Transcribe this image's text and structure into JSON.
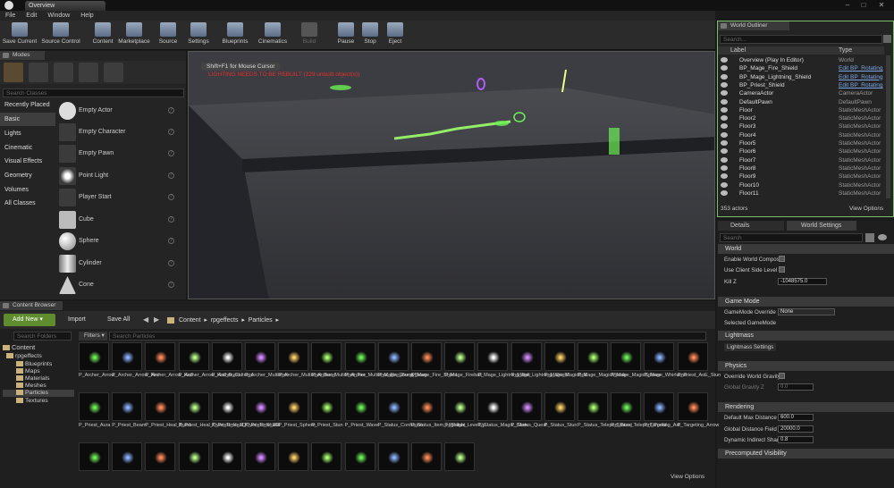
{
  "window": {
    "tab": "Overview"
  },
  "menu": [
    "File",
    "Edit",
    "Window",
    "Help"
  ],
  "toolbar": {
    "buttons": [
      {
        "label": "Save Current",
        "icon": "save-icon"
      },
      {
        "label": "Source Control",
        "icon": "source-control-icon"
      },
      {
        "label": "Content",
        "icon": "content-icon"
      },
      {
        "label": "Marketplace",
        "icon": "marketplace-icon"
      },
      {
        "label": "Source",
        "icon": "source-icon"
      },
      {
        "label": "Settings",
        "icon": "settings-icon"
      },
      {
        "label": "Blueprints",
        "icon": "blueprints-icon"
      },
      {
        "label": "Cinematics",
        "icon": "cinematics-icon"
      },
      {
        "label": "Build",
        "icon": "build-icon"
      },
      {
        "label": "Pause",
        "icon": "pause-icon"
      },
      {
        "label": "Stop",
        "icon": "stop-icon"
      },
      {
        "label": "Eject",
        "icon": "eject-icon"
      }
    ]
  },
  "modes": {
    "title": "Modes",
    "search_placeholder": "Search Classes",
    "categories": [
      "Recently Placed",
      "Basic",
      "Lights",
      "Cinematic",
      "Visual Effects",
      "Geometry",
      "Volumes",
      "All Classes"
    ],
    "selected_category": "Basic",
    "items": [
      "Empty Actor",
      "Empty Character",
      "Empty Pawn",
      "Point Light",
      "Player Start",
      "Cube",
      "Sphere",
      "Cylinder",
      "Cone"
    ]
  },
  "viewport": {
    "hint": "Shift+F1 for Mouse Cursor",
    "warning": "LIGHTING NEEDS TO BE REBUILT (229 unbuilt object(s))"
  },
  "world_outliner": {
    "title": "World Outliner",
    "search_placeholder": "Search...",
    "col_label": "Label",
    "col_type": "Type",
    "rows": [
      {
        "label": "Overview (Play In Editor)",
        "type": "World",
        "link": false
      },
      {
        "label": "BP_Mage_Fire_Shield",
        "type": "Edit BP_Rotating",
        "link": true
      },
      {
        "label": "BP_Mage_Lightning_Shield",
        "type": "Edit BP_Rotating",
        "link": true
      },
      {
        "label": "BP_Priest_Shield",
        "type": "Edit BP_Rotating",
        "link": true
      },
      {
        "label": "CameraActor",
        "type": "CameraActor",
        "link": false
      },
      {
        "label": "DefaultPawn",
        "type": "DefaultPawn",
        "link": false
      },
      {
        "label": "Floor",
        "type": "StaticMeshActor",
        "link": false
      },
      {
        "label": "Floor2",
        "type": "StaticMeshActor",
        "link": false
      },
      {
        "label": "Floor3",
        "type": "StaticMeshActor",
        "link": false
      },
      {
        "label": "Floor4",
        "type": "StaticMeshActor",
        "link": false
      },
      {
        "label": "Floor5",
        "type": "StaticMeshActor",
        "link": false
      },
      {
        "label": "Floor6",
        "type": "StaticMeshActor",
        "link": false
      },
      {
        "label": "Floor7",
        "type": "StaticMeshActor",
        "link": false
      },
      {
        "label": "Floor8",
        "type": "StaticMeshActor",
        "link": false
      },
      {
        "label": "Floor9",
        "type": "StaticMeshActor",
        "link": false
      },
      {
        "label": "Floor10",
        "type": "StaticMeshActor",
        "link": false
      },
      {
        "label": "Floor11",
        "type": "StaticMeshActor",
        "link": false
      }
    ],
    "actor_count": "353 actors",
    "view_options": "View Options"
  },
  "details": {
    "tab_details": "Details",
    "tab_world_settings": "World Settings",
    "search_placeholder": "Search",
    "world": {
      "title": "World",
      "enable_world_composition": "Enable World Compos",
      "use_client_side_level": "Use Client Side Level",
      "kill_z_label": "Kill Z",
      "kill_z_value": "-1048575.0"
    },
    "game_mode": {
      "title": "Game Mode",
      "override_label": "GameMode Override",
      "override_value": "None",
      "selected_label": "Selected GameMode"
    },
    "lightmass": {
      "title": "Lightmass",
      "settings": "Lightmass Settings"
    },
    "physics": {
      "title": "Physics",
      "override_gravity": "Override World Gravity",
      "global_gravity_label": "Global Gravity Z",
      "global_gravity_value": "0.0"
    },
    "rendering": {
      "title": "Rendering",
      "default_max_distance_label": "Default Max Distance",
      "default_max_distance_value": "600.0",
      "global_distance_field_label": "Global Distance Field V",
      "global_distance_field_value": "20000.0",
      "dynamic_indirect_label": "Dynamic Indirect Shad",
      "dynamic_indirect_value": "0.8"
    },
    "precomputed": {
      "title": "Precomputed Visibility"
    }
  },
  "content_browser": {
    "title": "Content Browser",
    "add_new": "Add New",
    "import": "Import",
    "save_all": "Save All",
    "breadcrumb": [
      "Content",
      "rpgeffects",
      "Particles"
    ],
    "search_folders": "Search Folders",
    "filters": "Filters",
    "search_particles": "Search Particles",
    "folders": [
      "Content",
      "rpgeffects",
      "Blueprints",
      "Maps",
      "Materials",
      "Meshes",
      "Particles",
      "Textures"
    ],
    "selected_folder": "Particles",
    "assets_row1": [
      "P_Archer_Arrow",
      "P_Archer_Arrow_Fire",
      "P_Archer_Arrow_Hail",
      "P_Archer_Arrow_Hail_Burst",
      "P_Archer_Caltrops",
      "P_Archer_Multishot",
      "P_Archer_Multishot_Burst",
      "P_Archer_Multishot_Fire",
      "P_Archer_Multishot_Fire_Burst",
      "P_Mage_EnergyBeam",
      "P_Mage_Fire_Shield",
      "P_Mage_Fireball",
      "P_Mage_Lightning_Bolt",
      "P_Mage_Lightning_Shield",
      "P_Mage_MagicBolt",
      "P_Mage_MagicMissile",
      "P_Mage_MagicSphere",
      "P_Mage_Whirlwind",
      "P_Priest_AoE_Stun"
    ],
    "assets_row2": [
      "P_Priest_Aura",
      "P_Priest_Beam",
      "P_Priest_Heal_Burst",
      "P_Priest_Heal_Over_Time_3D",
      "P_Priest_Heal_Over_Time_3D",
      "P_Priest_Shield",
      "P_Priest_Sphere",
      "P_Priest_Stun",
      "P_Priest_Wave",
      "P_Status_Confusion",
      "P_Status_Item_Highlight",
      "P_Status_LevelUp",
      "P_Status_Magic_Glow",
      "P_Status_Quest",
      "P_Status_Stun",
      "P_Status_Teleport_Burst",
      "P_Status_Teleport_Portal",
      "P_Targeting_Arc",
      "P_Targeting_Arrow"
    ],
    "row3_count": 12,
    "view_options": "View Options"
  }
}
